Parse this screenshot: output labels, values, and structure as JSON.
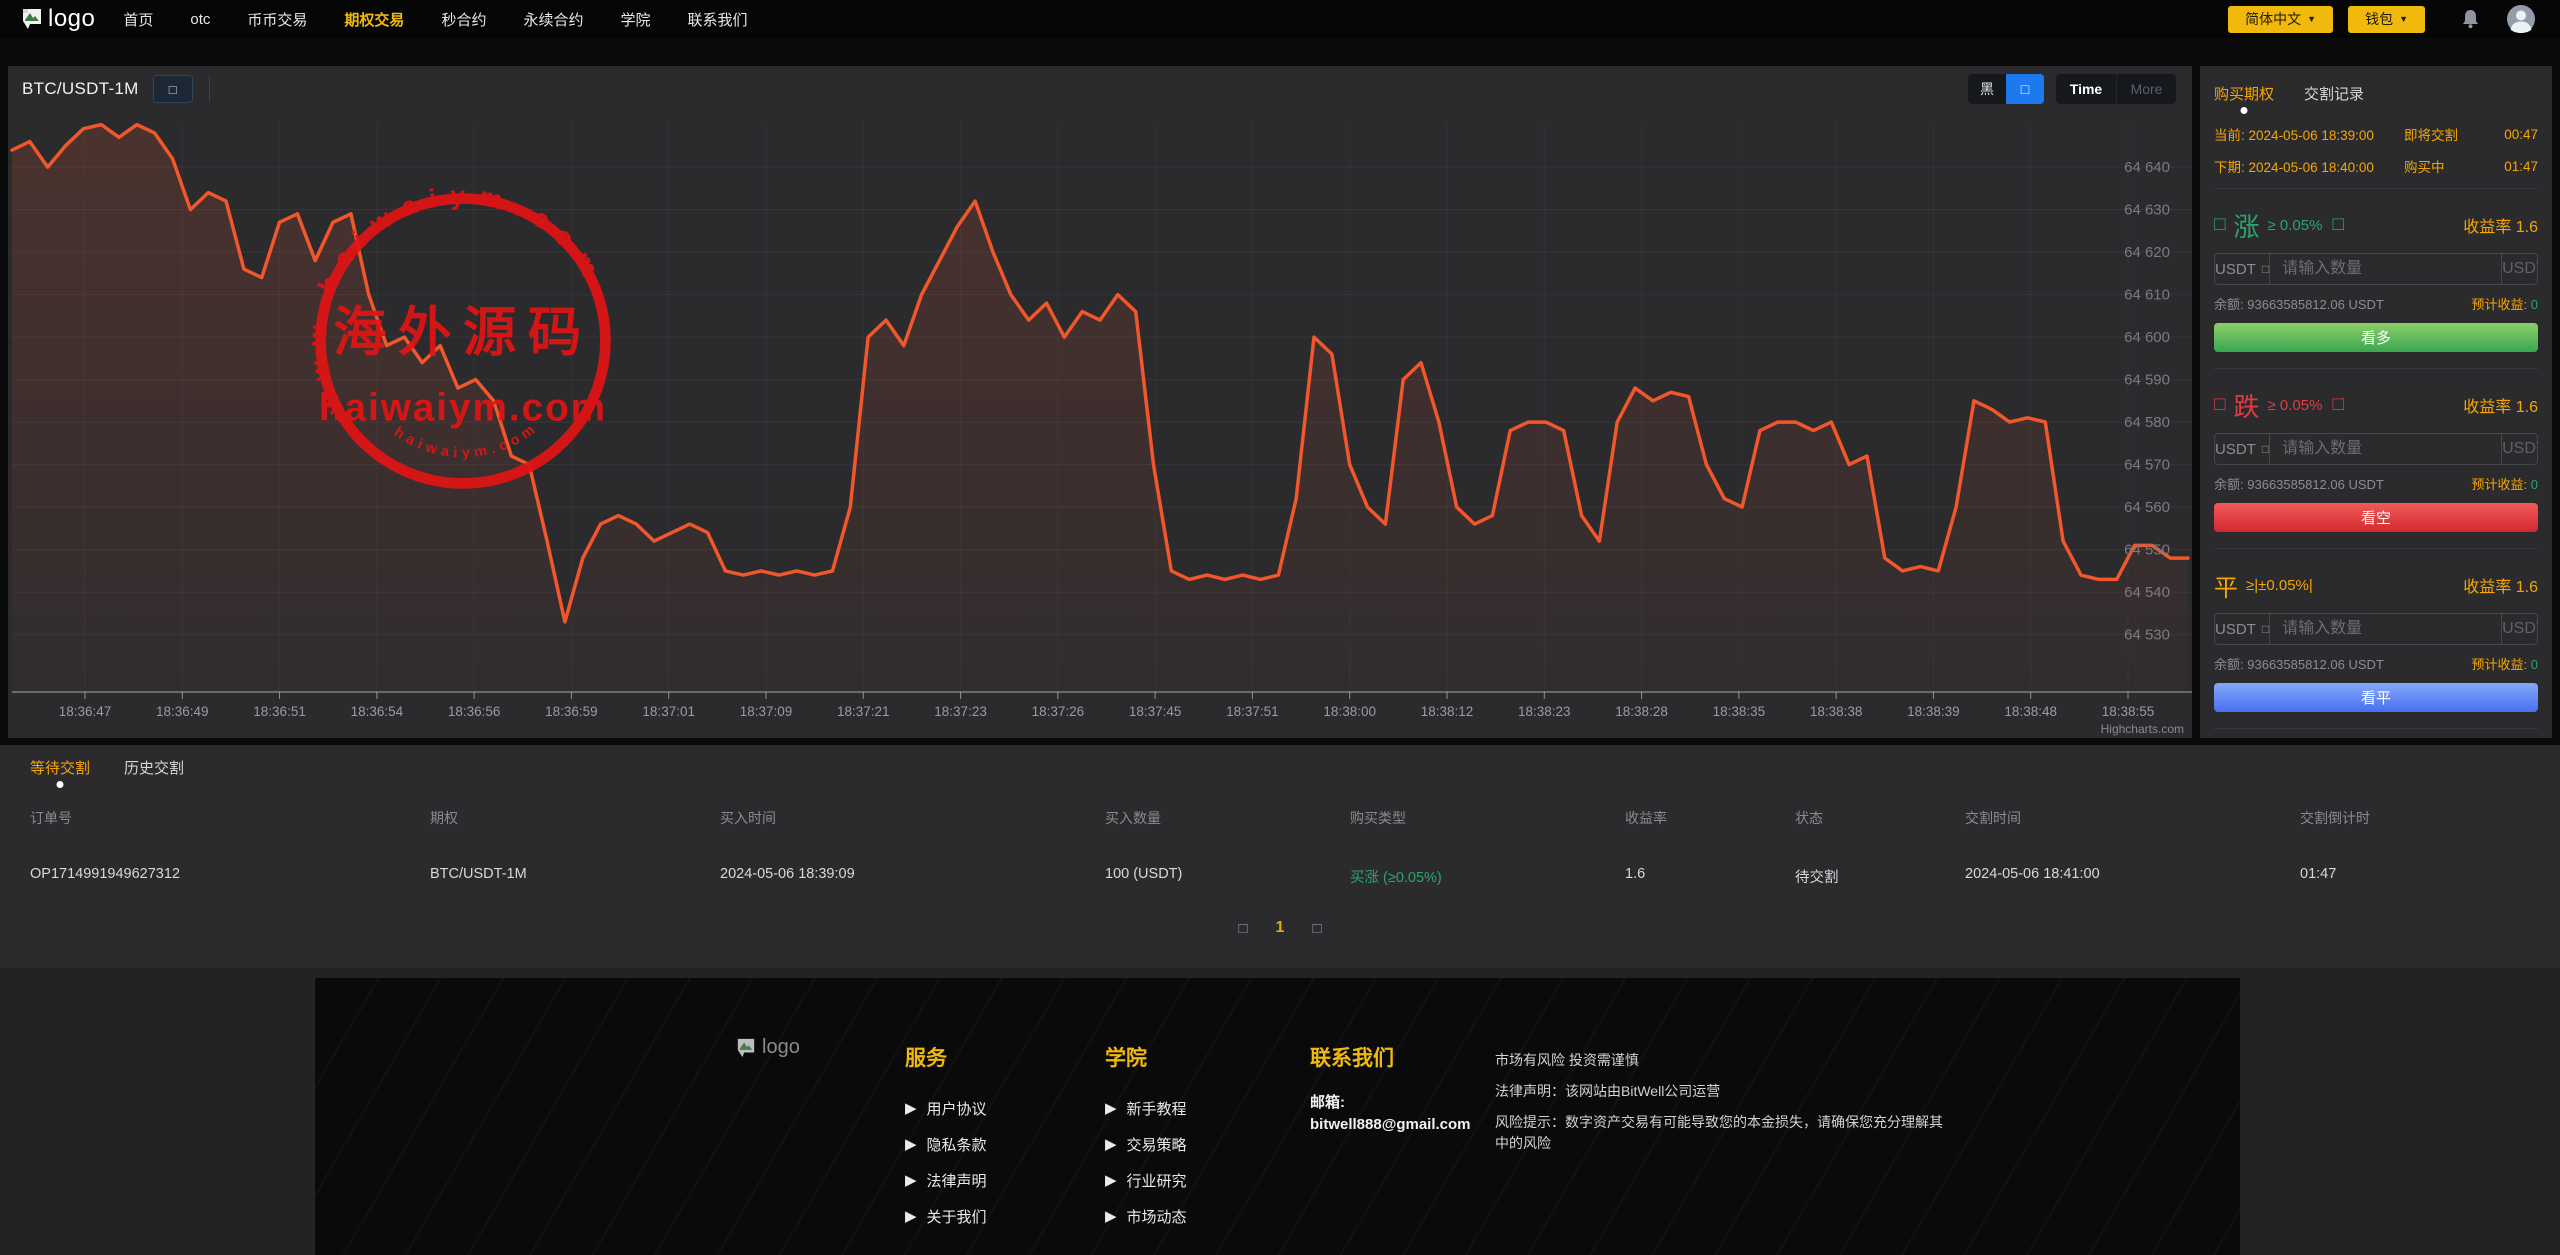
{
  "icons": {
    "tofu": "□",
    "caret": "▼",
    "bullet": "▶"
  },
  "colors": {
    "accent_yellow": "#f0b90b",
    "accent_orange": "#f7a600",
    "green": "#2ba56e",
    "red": "#e23b41",
    "blue": "#4a6ef2",
    "line": "#f2572b"
  },
  "header": {
    "logo_alt": "logo",
    "nav": [
      "首页",
      "otc",
      "币币交易",
      "期权交易",
      "秒合约",
      "永续合约",
      "学院",
      "联系我们"
    ],
    "lang_button": "简体中文",
    "wallet_button": "钱包"
  },
  "chart": {
    "symbol": "BTC/USDT-1M",
    "theme_button": "黑",
    "time_button": "Time",
    "more_button": "More",
    "credit": "Highcharts.com",
    "watermark_top": "www.haiwaiym.com",
    "watermark_center": "海外源码",
    "watermark_name": "haiwaiym.com",
    "watermark_bottom": "haiwaiym.com"
  },
  "chart_data": {
    "type": "line",
    "title": "BTC/USDT-1M",
    "legend": "none",
    "grid": true,
    "x_labels": [
      "18:36:47",
      "18:36:49",
      "18:36:51",
      "18:36:54",
      "18:36:56",
      "18:36:59",
      "18:37:01",
      "18:37:09",
      "18:37:21",
      "18:37:23",
      "18:37:26",
      "18:37:45",
      "18:37:51",
      "18:38:00",
      "18:38:12",
      "18:38:23",
      "18:38:28",
      "18:38:35",
      "18:38:38",
      "18:38:39",
      "18:38:48",
      "18:38:55"
    ],
    "y_labels": [
      "64 640",
      "64 630",
      "64 620",
      "64 610",
      "64 600",
      "64 590",
      "64 580",
      "64 570",
      "64 560",
      "64 550",
      "64 540",
      "64 530"
    ],
    "y_values": [
      64640,
      64630,
      64620,
      64610,
      64600,
      64590,
      64580,
      64570,
      64560,
      64550,
      64540,
      64530
    ],
    "ylim": [
      64516.5,
      64650.6
    ],
    "line_color": "#f2572b",
    "values": [
      64644,
      64646,
      64640,
      64645,
      64649,
      64650,
      64647,
      64650,
      64648,
      64642,
      64630,
      64634,
      64632,
      64616,
      64614,
      64627,
      64629,
      64618,
      64627,
      64629,
      64610,
      64598,
      64600,
      64594,
      64598,
      64588,
      64590,
      64585,
      64572,
      64570,
      64552,
      64533,
      64548,
      64556,
      64558,
      64556,
      64552,
      64554,
      64556,
      64554,
      64545,
      64544,
      64545,
      64544,
      64545,
      64544,
      64545,
      64560,
      64600,
      64604,
      64598,
      64610,
      64618,
      64626,
      64632,
      64620,
      64610,
      64604,
      64608,
      64600,
      64606,
      64604,
      64610,
      64606,
      64570,
      64545,
      64543,
      64544,
      64543,
      64544,
      64543,
      64544,
      64562,
      64600,
      64596,
      64570,
      64560,
      64556,
      64590,
      64594,
      64580,
      64560,
      64556,
      64558,
      64578,
      64580,
      64580,
      64578,
      64558,
      64552,
      64580,
      64588,
      64585,
      64587,
      64586,
      64570,
      64562,
      64560,
      64578,
      64580,
      64580,
      64578,
      64580,
      64570,
      64572,
      64548,
      64545,
      64546,
      64545,
      64560,
      64585,
      64583,
      64580,
      64581,
      64580,
      64552,
      64544,
      64543,
      64543,
      64551,
      64551,
      64548,
      64548
    ]
  },
  "panel": {
    "tab_buy": "购买期权",
    "tab_records": "交割记录",
    "current_label": "当前:",
    "current_time": "2024-05-06 18:39:00",
    "current_status": "即将交割",
    "current_countdown": "00:47",
    "next_label": "下期:",
    "next_time": "2024-05-06 18:40:00",
    "next_status": "购买中",
    "next_countdown": "01:47",
    "rate_label": "收益率",
    "balance_label": "余额:",
    "est_label": "预计收益:",
    "blocks": [
      {
        "name": "涨",
        "cond": "≥ 0.05%",
        "rate": "1.6",
        "unit_left": "USDT",
        "placeholder": "请输入数量",
        "unit_right": "USDT",
        "balance": "93663585812.06 USDT",
        "est": "0",
        "button": "看多"
      },
      {
        "name": "跌",
        "cond": "≥ 0.05%",
        "rate": "1.6",
        "unit_left": "USDT",
        "placeholder": "请输入数量",
        "unit_right": "USDT",
        "balance": "93663585812.06 USDT",
        "est": "0",
        "button": "看空"
      },
      {
        "name": "平",
        "cond": "≥|±0.05%|",
        "rate": "1.6",
        "unit_left": "USDT",
        "placeholder": "请输入数量",
        "unit_right": "USDT",
        "balance": "93663585812.06 USDT",
        "est": "0",
        "button": "看平"
      }
    ]
  },
  "orders": {
    "tab_waiting": "等待交割",
    "tab_history": "历史交割",
    "columns": [
      "订单号",
      "期权",
      "买入时间",
      "买入数量",
      "购买类型",
      "收益率",
      "状态",
      "交割时间",
      "交割倒计时"
    ],
    "rows": [
      [
        "OP1714991949627312",
        "BTC/USDT-1M",
        "2024-05-06 18:39:09",
        "100 (USDT)",
        "买涨 (≥0.05%)",
        "1.6",
        "待交割",
        "2024-05-06 18:41:00",
        "01:47"
      ]
    ],
    "page": "1"
  },
  "footer": {
    "logo_alt": "logo",
    "columns": [
      {
        "title": "服务",
        "links": [
          "用户协议",
          "隐私条款",
          "法律声明",
          "关于我们"
        ]
      },
      {
        "title": "学院",
        "links": [
          "新手教程",
          "交易策略",
          "行业研究",
          "市场动态"
        ]
      }
    ],
    "contact_title": "联系我们",
    "email_label": "邮箱:",
    "email": "bitwell888@gmail.com",
    "disclaimer1": "市场有风险 投资需谨慎",
    "disclaimer2": "法律声明：该网站由BitWell公司运营",
    "disclaimer3": "风险提示：数字资产交易有可能导致您的本金损失，请确保您充分理解其中的风险"
  }
}
